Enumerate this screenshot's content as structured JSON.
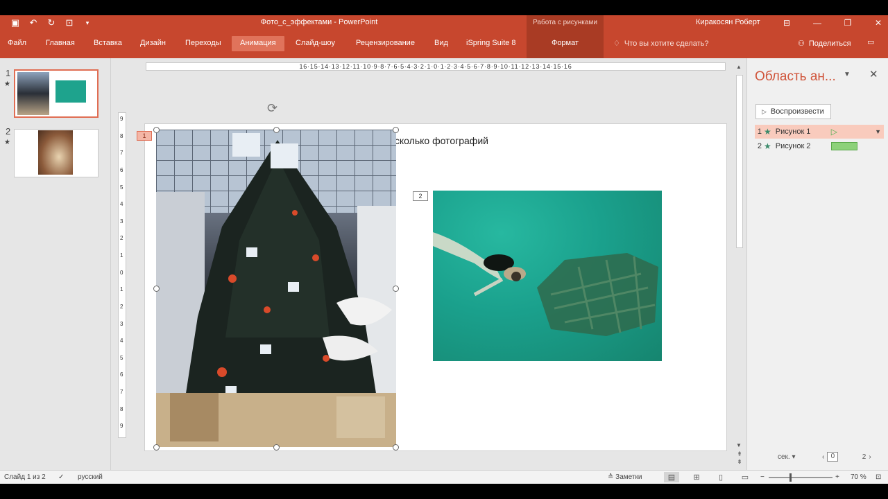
{
  "window": {
    "title": "Фото_с_эффектами  -  PowerPoint",
    "context_header": "Работа с рисунками",
    "user": "Киракосян Роберт"
  },
  "ribbon": {
    "tabs": [
      {
        "label": "Файл",
        "active": false
      },
      {
        "label": "Главная",
        "active": false
      },
      {
        "label": "Вставка",
        "active": false
      },
      {
        "label": "Дизайн",
        "active": false
      },
      {
        "label": "Переходы",
        "active": false
      },
      {
        "label": "Анимация",
        "active": true
      },
      {
        "label": "Слайд-шоу",
        "active": false
      },
      {
        "label": "Рецензирование",
        "active": false
      },
      {
        "label": "Вид",
        "active": false
      },
      {
        "label": "iSpring Suite 8",
        "active": false
      }
    ],
    "context_tab": "Формат",
    "tell_me": "Что вы хотите сделать?",
    "share": "Поделиться"
  },
  "thumbnails": {
    "items": [
      {
        "number": "1",
        "star": "★"
      },
      {
        "number": "2",
        "star": "★"
      }
    ]
  },
  "slide": {
    "title": "Несколько фотографий",
    "anim_tag_1": "1",
    "anim_tag_2": "2"
  },
  "ruler": {
    "h_labels": "16·15·14·13·12·11·10·9·8·7·6·5·4·3·2·1·0·1·2·3·4·5·6·7·8·9·10·11·12·13·14·15·16",
    "v_labels": [
      "9",
      "8",
      "7",
      "6",
      "5",
      "4",
      "3",
      "2",
      "1",
      "0",
      "1",
      "2",
      "3",
      "4",
      "5",
      "6",
      "7",
      "8",
      "9"
    ]
  },
  "animation_pane": {
    "title": "Область ан...",
    "play_label": "Воспроизвести",
    "items": [
      {
        "number": "1",
        "label": "Рисунок 1"
      },
      {
        "number": "2",
        "label": "Рисунок 2"
      }
    ],
    "sec_label": "сек.",
    "timeline_start": "0",
    "timeline_end": "2"
  },
  "status": {
    "slide_info": "Слайд 1 из 2",
    "language": "русский",
    "notes": "Заметки",
    "zoom": "70 %"
  },
  "colors": {
    "accent": "#c7472e",
    "context_tab": "#a93b24",
    "pane_title": "#d0553b"
  }
}
